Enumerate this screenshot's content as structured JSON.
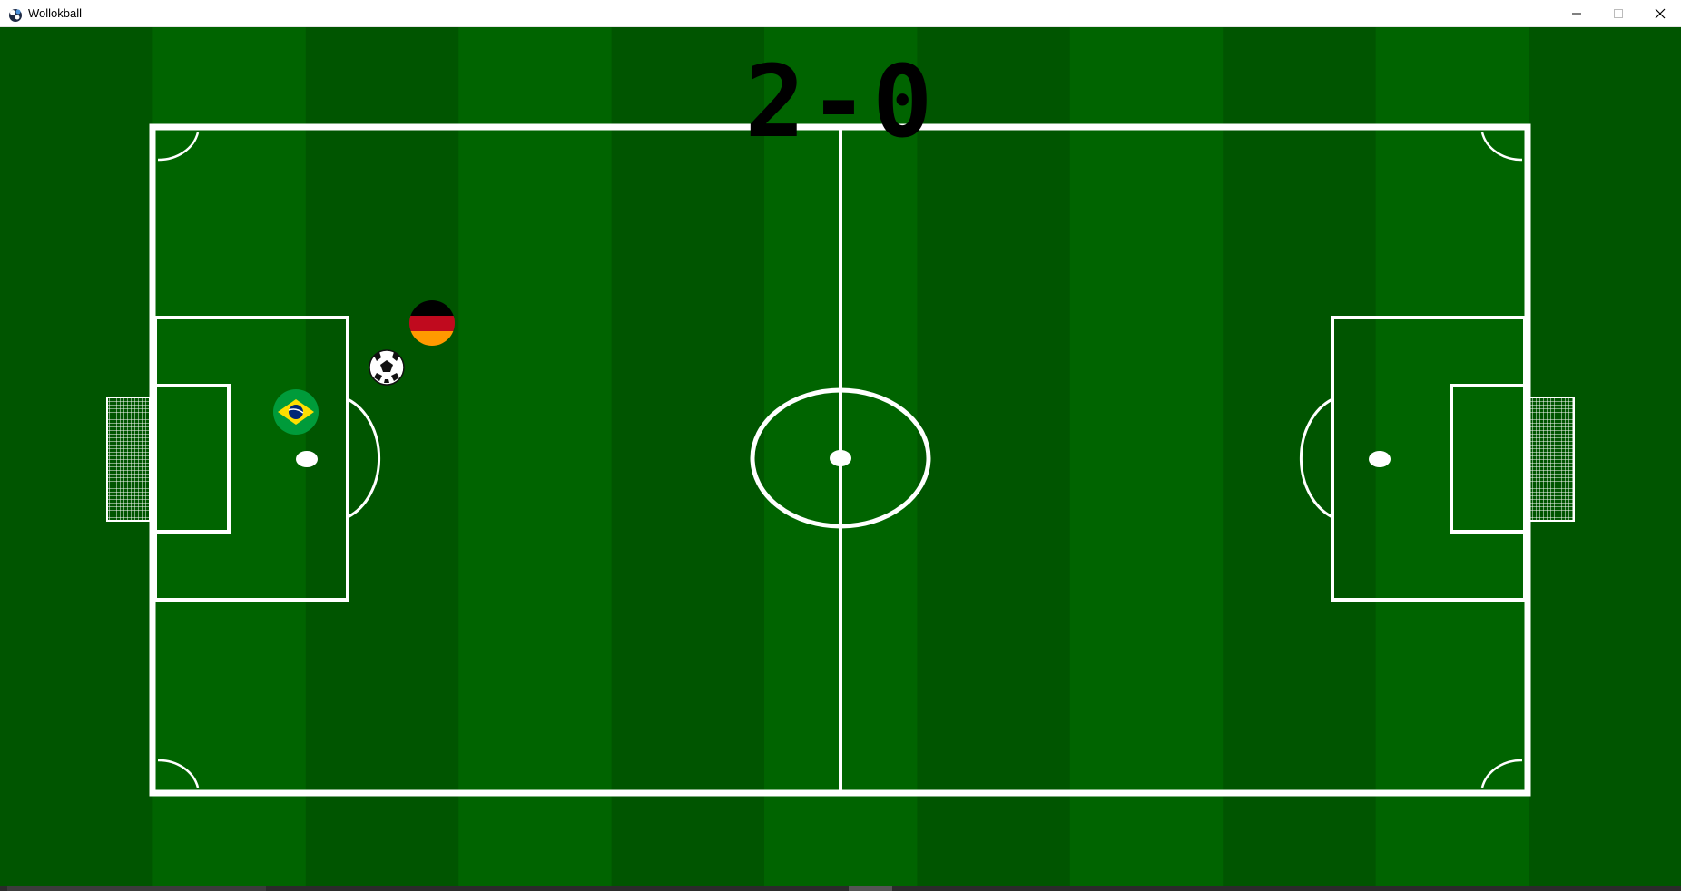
{
  "window": {
    "title": "Wollokball",
    "app_icon": "wollok-icon",
    "controls": [
      "minimize-icon",
      "maximize-icon",
      "close-icon"
    ]
  },
  "game": {
    "score": "2-0",
    "players": [
      {
        "name": "brazil",
        "icon": "brazil-flag-icon"
      },
      {
        "name": "germany",
        "icon": "germany-flag-icon"
      }
    ],
    "ball_icon": "soccer-ball-icon"
  },
  "colors": {
    "stripe_dark": "#005500",
    "stripe_light": "#006400",
    "lines": "#ffffff",
    "score_text": "#000000"
  }
}
